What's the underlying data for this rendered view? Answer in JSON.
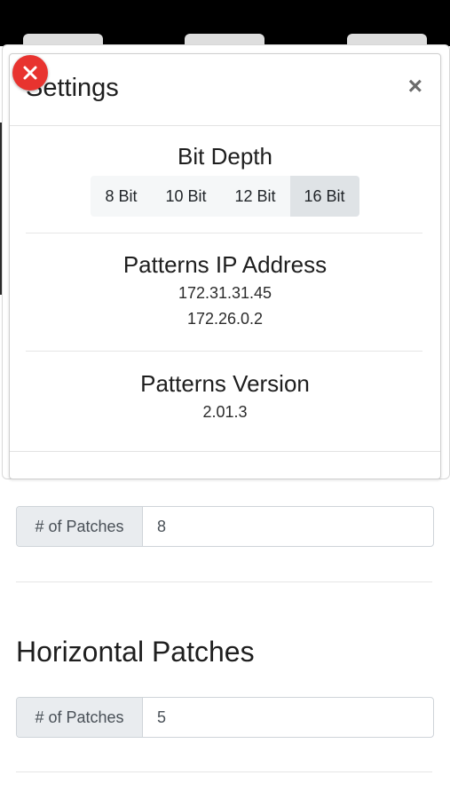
{
  "modal": {
    "title": "Settings",
    "close_symbol": "×",
    "bit_depth": {
      "title": "Bit Depth",
      "options": [
        "8 Bit",
        "10 Bit",
        "12 Bit",
        "16 Bit"
      ],
      "selected": "16 Bit"
    },
    "patterns_ip": {
      "title": "Patterns IP Address",
      "addresses": [
        "172.31.31.45",
        "172.26.0.2"
      ]
    },
    "patterns_version": {
      "title": "Patterns Version",
      "value": "2.01.3"
    }
  },
  "vertical_patches": {
    "label": "# of Patches",
    "value": "8"
  },
  "horizontal_patches": {
    "heading": "Horizontal Patches",
    "label": "# of Patches",
    "value": "5"
  },
  "colors": {
    "close_badge": "#e8332f",
    "active_segment": "#dfe3e6",
    "input_addon": "#e9ecef"
  }
}
